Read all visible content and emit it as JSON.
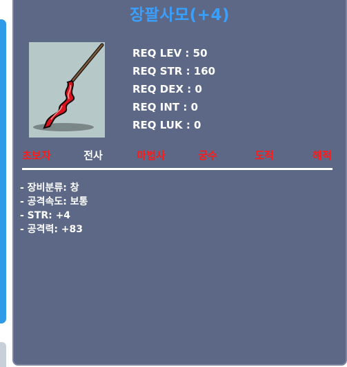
{
  "item": {
    "name": "장팔사모(+4)",
    "icon": "spear-icon"
  },
  "requirements": [
    "REQ LEV : 50",
    "REQ STR : 160",
    "REQ DEX : 0",
    "REQ INT : 0",
    "REQ LUK : 0"
  ],
  "jobs": [
    {
      "label": "초보자",
      "color": "#ff1a1a"
    },
    {
      "label": "전사",
      "color": "#ffffff"
    },
    {
      "label": "마법사",
      "color": "#ff1a1a"
    },
    {
      "label": "궁수",
      "color": "#ff1a1a"
    },
    {
      "label": "도적",
      "color": "#ff1a1a"
    },
    {
      "label": "해적",
      "color": "#ff1a1a"
    }
  ],
  "stats": [
    "- 장비분류: 창",
    "- 공격속도: 보통",
    "- STR: +4",
    "- 공격력: +83"
  ],
  "colors": {
    "panel_bg": "#5c6886",
    "title": "#3aa0ff",
    "unavailable_job": "#ff1a1a",
    "available_job": "#ffffff"
  }
}
